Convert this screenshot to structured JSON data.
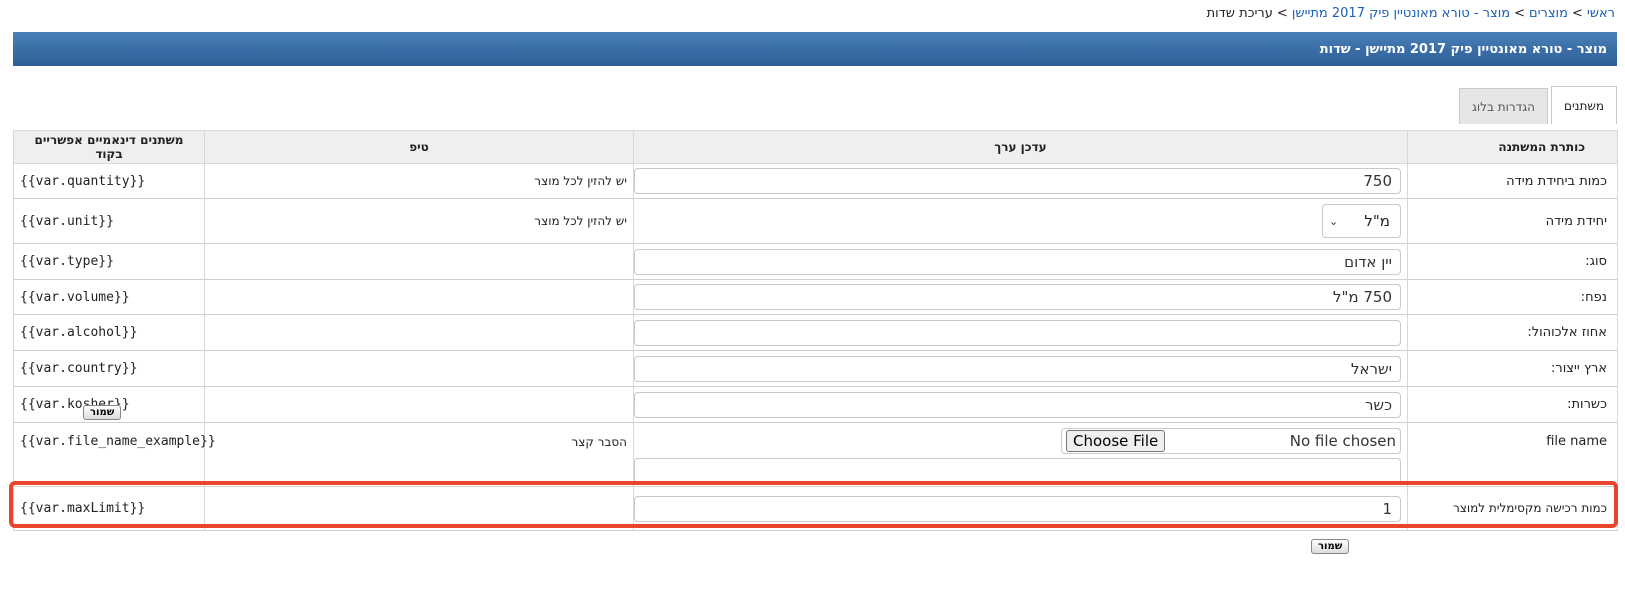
{
  "breadcrumb": {
    "items": [
      {
        "label": "ראשי",
        "link": true
      },
      {
        "label": "מוצרים",
        "link": true
      },
      {
        "label": "מוצר - טורא מאונטיין פיק 2017 מתיישן",
        "link": true
      },
      {
        "label": "עריכת שדות",
        "link": false
      }
    ],
    "separator": ">"
  },
  "header": {
    "title": "מוצר - טורא מאונטיין פיק 2017 מתיישן - שדות"
  },
  "tabs": [
    {
      "label": "משתנים",
      "active": true
    },
    {
      "label": "הגדרות בלוג",
      "active": false
    }
  ],
  "table": {
    "headers": {
      "name": "כותרת המשתנה",
      "editor": "עדכן ערך",
      "tip": "טיפ",
      "code": "משתנים דינאמיים אפשריים בקוד"
    },
    "rows": [
      {
        "name": "כמות ביחידת מידה",
        "value": "750",
        "tip": "יש להזין לכל מוצר",
        "code": "{{var.quantity}}"
      },
      {
        "name": "יחידת מידה",
        "select_value": "מ\"ל",
        "tip": "יש להזין לכל מוצר",
        "code": "{{var.unit}}"
      },
      {
        "name": "סוג:",
        "value": "יין אדום",
        "tip": "",
        "code": "{{var.type}}"
      },
      {
        "name": "נפח:",
        "value": "750 מ\"ל",
        "tip": "",
        "code": "{{var.volume}}"
      },
      {
        "name": "אחוז אלכוהול:",
        "value": "",
        "tip": "",
        "code": "{{var.alcohol}}"
      },
      {
        "name": "ארץ ייצור:",
        "value": "ישראל",
        "tip": "",
        "code": "{{var.country}}"
      },
      {
        "name": "כשרות:",
        "value": "כשר",
        "tip": "",
        "code": "{{var.kosher}}"
      },
      {
        "name": "file name",
        "file_status": "No file chosen",
        "file_button": "Choose File",
        "value": "",
        "tip": "הסבר קצר",
        "code": "{{var.file_name_example}}"
      },
      {
        "name": "כמות רכישה מקסימלית למוצר",
        "value": "1",
        "tip": "",
        "code": "{{var.maxLimit}}"
      }
    ]
  },
  "buttons": {
    "save_label": "שמור"
  },
  "colors": {
    "header_bar": "#2d5e98",
    "link": "#1a5fb4",
    "highlight": "#e8462b"
  }
}
